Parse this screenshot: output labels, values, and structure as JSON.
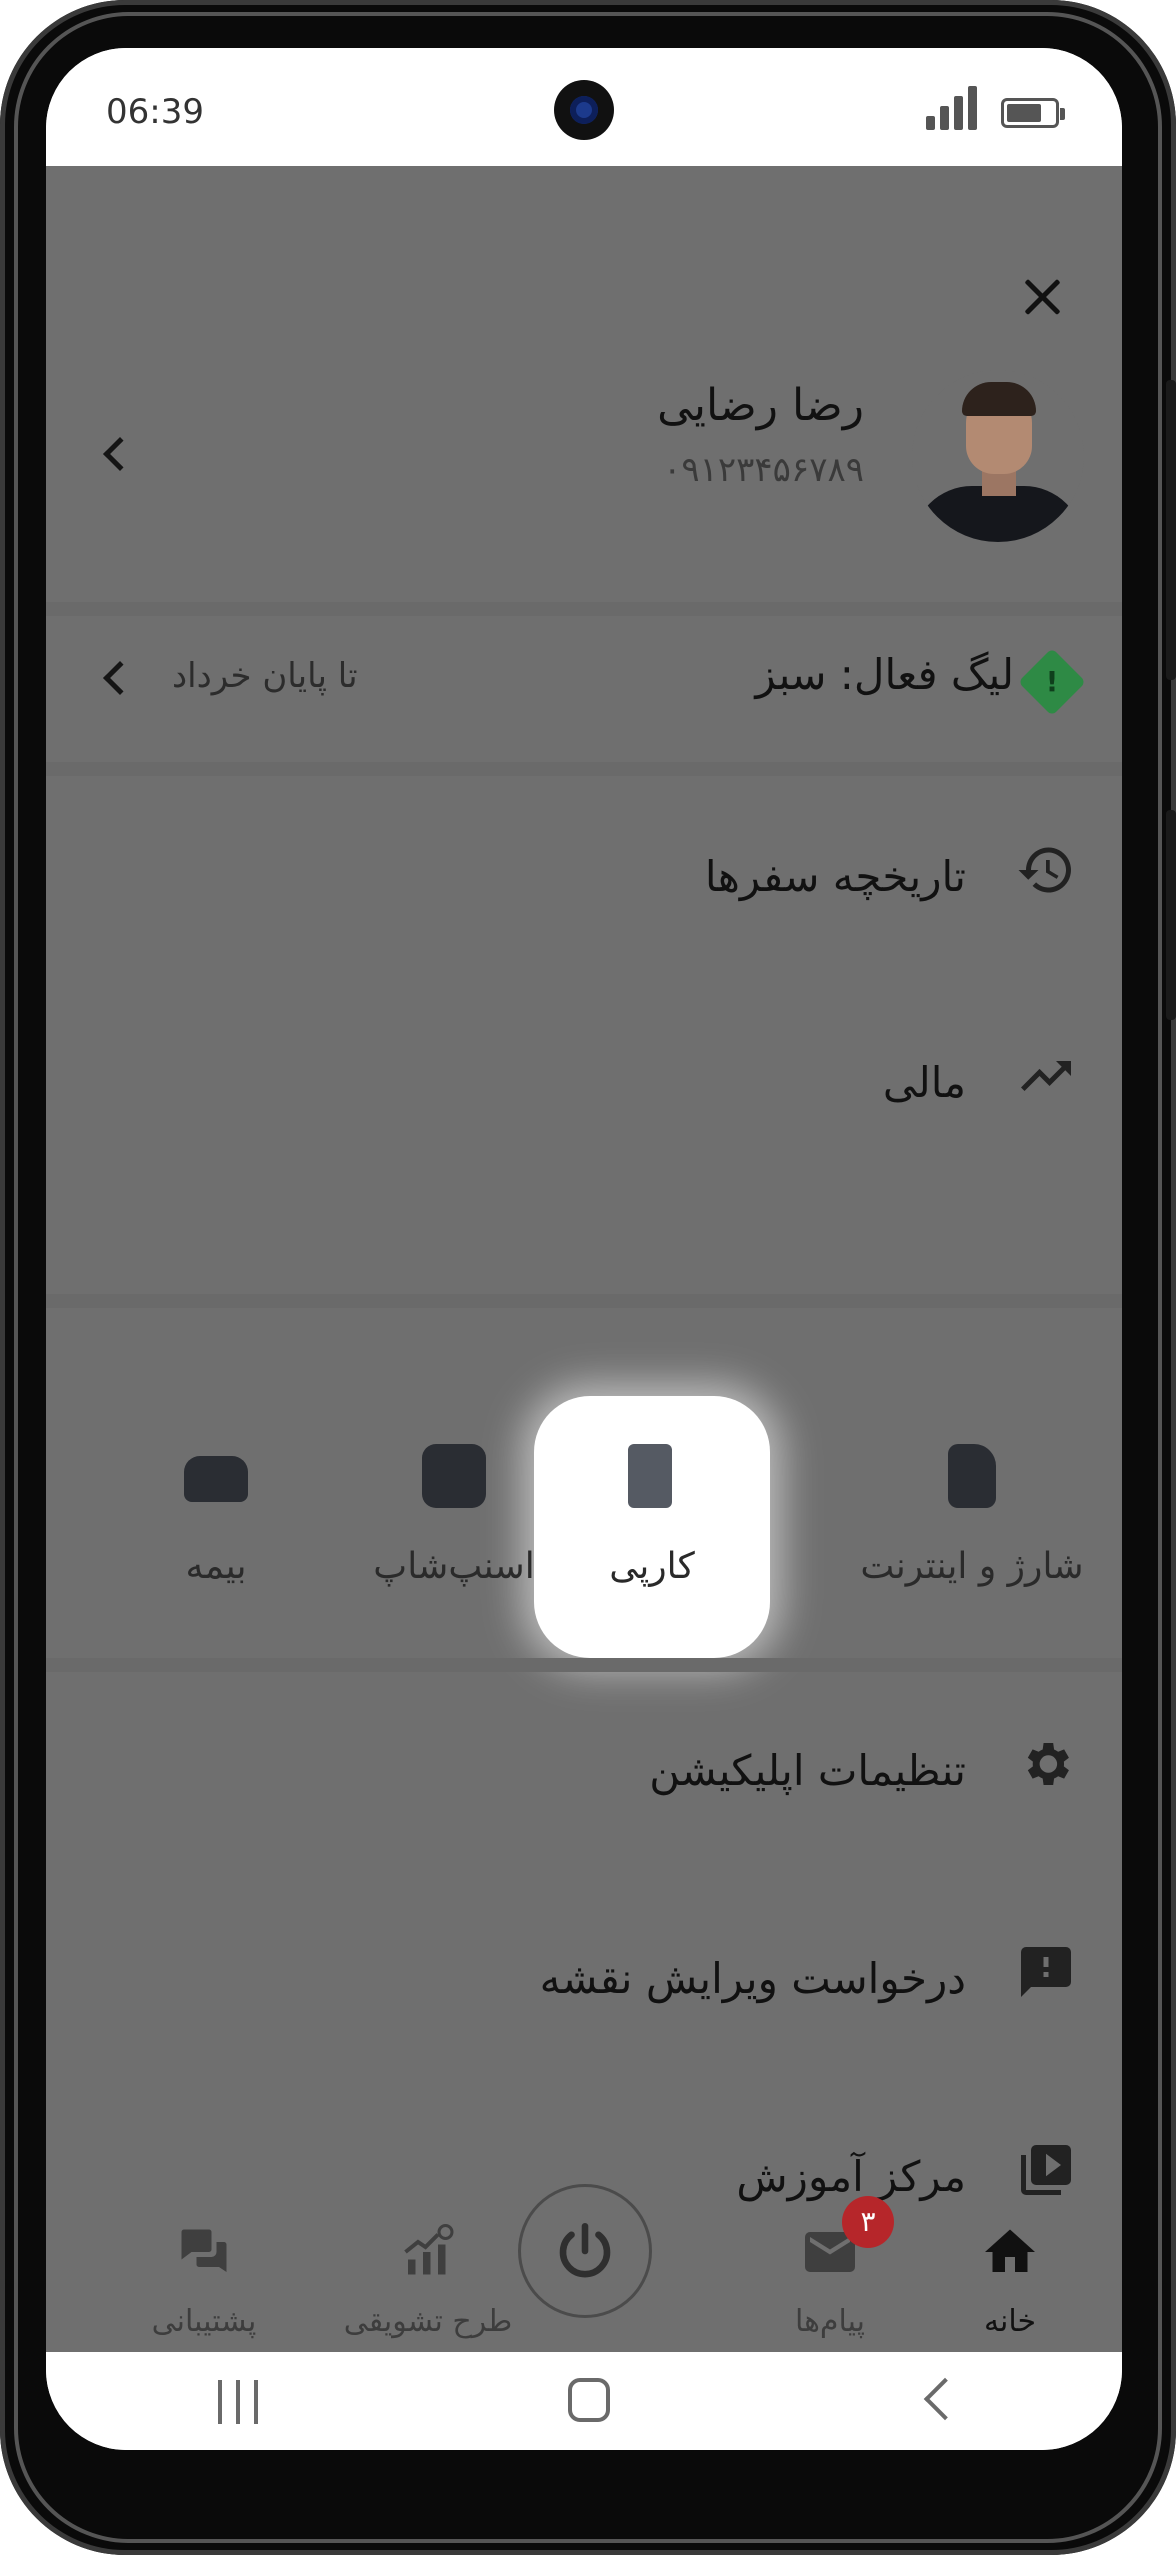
{
  "status_bar": {
    "time": "06:39",
    "signal_icon": "signal-strength-icon",
    "battery_icon": "battery-icon"
  },
  "drawer": {
    "close_icon": "close-icon",
    "profile": {
      "name": "رضا رضایی",
      "phone": "۰۹۱۲۳۴۵۶۷۸۹",
      "avatar": "driver-avatar"
    },
    "league": {
      "label": "لیگ فعال: سبز",
      "end_text": "تا پایان خرداد",
      "icon_glyph": "!",
      "color": "#2e8a45"
    },
    "menu_top": [
      {
        "label": "تاریخچه سفرها",
        "icon": "history-icon"
      },
      {
        "label": "مالی",
        "icon": "trending-up-icon"
      }
    ],
    "quick_actions": [
      {
        "label": "شارژ و اینترنت",
        "icon": "sim-card-icon"
      },
      {
        "label": "کارپی",
        "icon": "receipt-icon",
        "highlighted": true
      },
      {
        "label": "اسنپ‌شاپ",
        "icon": "shopping-bag-icon"
      },
      {
        "label": "بیمه",
        "icon": "car-insurance-icon"
      }
    ],
    "menu_bottom": [
      {
        "label": "تنظیمات اپلیکیشن",
        "icon": "settings-icon"
      },
      {
        "label": "درخواست ویرایش نقشه",
        "icon": "feedback-icon"
      },
      {
        "label": "مرکز آموزش",
        "icon": "video-library-icon"
      }
    ]
  },
  "bottom_nav": {
    "items": [
      {
        "label": "خانه",
        "icon": "home-icon",
        "active": true
      },
      {
        "label": "پیام‌ها",
        "icon": "mail-icon",
        "badge": "۳"
      },
      {
        "label": "طرح تشویقی",
        "icon": "incentive-chart-icon"
      },
      {
        "label": "پشتیبانی",
        "icon": "support-chat-icon"
      }
    ],
    "power_icon": "power-icon"
  },
  "system_nav": {
    "recents_icon": "recents-icon",
    "home_icon": "system-home-icon",
    "back_icon": "system-back-icon"
  }
}
